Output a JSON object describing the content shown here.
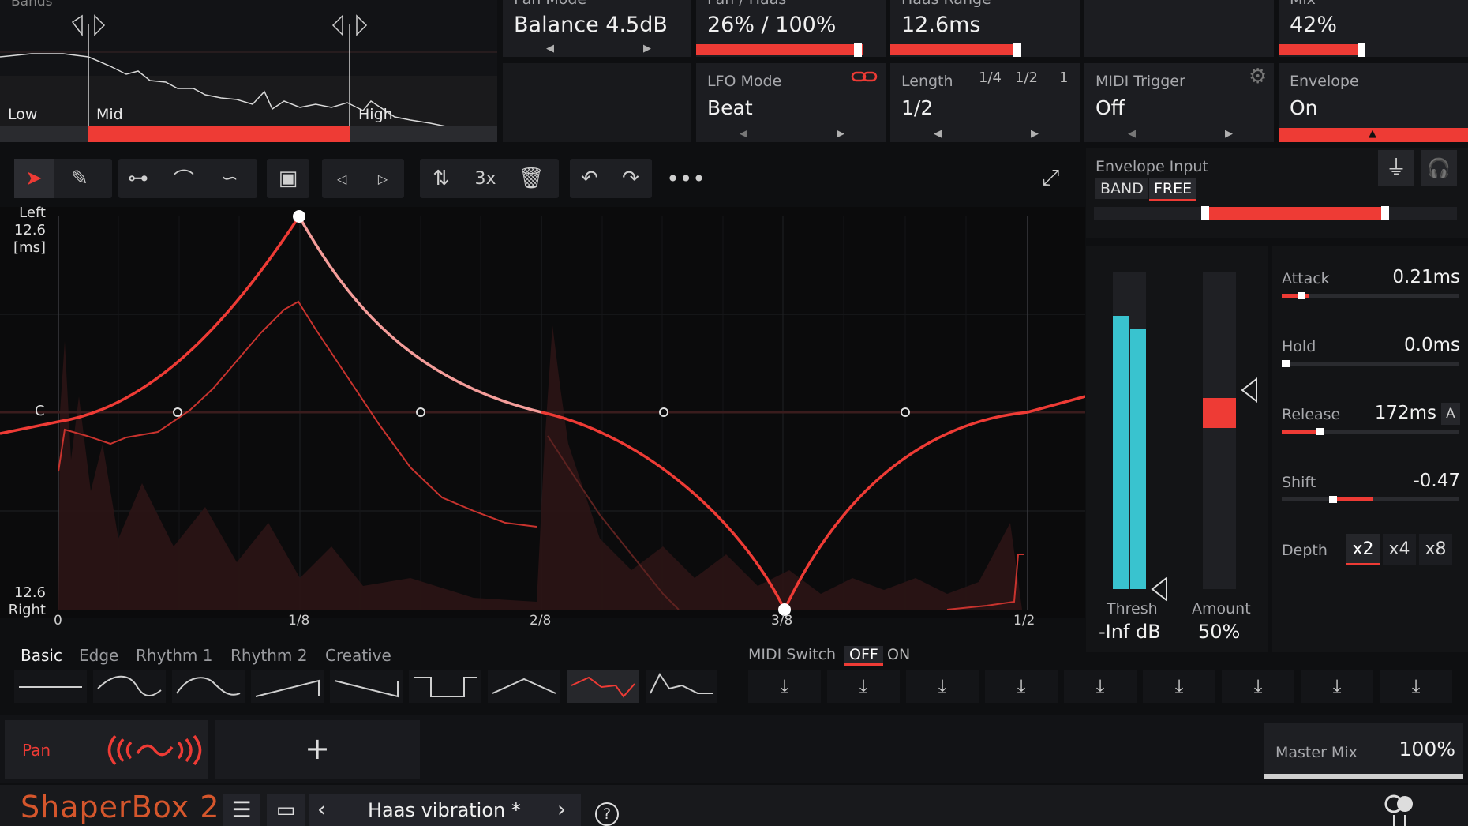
{
  "top": {
    "bands": {
      "title": "Bands",
      "labels": [
        "Low",
        "Mid",
        "High"
      ]
    },
    "pan_mode": {
      "label": "Pan Mode",
      "value": "Balance 4.5dB"
    },
    "pan_haas": {
      "label": "Pan / Haas",
      "value": "26% / 100%",
      "fill": 0.95
    },
    "haas_range": {
      "label": "Haas Range",
      "value": "12.6ms",
      "fill": 0.66
    },
    "mix": {
      "label": "Mix",
      "value": "42%",
      "fill": 0.42
    },
    "lfo_mode": {
      "label": "LFO Mode",
      "value": "Beat"
    },
    "length": {
      "label": "Length",
      "value": "1/2",
      "options": [
        "1/4",
        "1/2",
        "1"
      ]
    },
    "midi_trigger": {
      "label": "MIDI Trigger",
      "value": "Off"
    },
    "envelope": {
      "label": "Envelope",
      "value": "On"
    }
  },
  "toolbar": {
    "multiplier": "3x",
    "icons": [
      "pointer-icon",
      "pencil-icon",
      "line-icon",
      "curve-icon",
      "s-curve-icon",
      "select-all-icon",
      "nudge-left-icon",
      "nudge-right-icon",
      "flip-icon",
      "delete-icon",
      "undo-icon",
      "redo-icon",
      "more-icon",
      "expand-icon"
    ]
  },
  "graph": {
    "y_top": [
      "Left",
      "12.6",
      "[ms]"
    ],
    "y_mid": "C",
    "y_bottom": [
      "12.6",
      "Right"
    ],
    "x_ticks": [
      "0",
      "1/8",
      "2/8",
      "3/8",
      "1/2"
    ]
  },
  "shape_tabs": [
    "Basic",
    "Edge",
    "Rhythm 1",
    "Rhythm 2",
    "Creative"
  ],
  "midi_switch": {
    "label": "MIDI Switch",
    "off": "OFF",
    "on": "ON"
  },
  "envelope_panel": {
    "input_label": "Envelope Input",
    "band": "BAND",
    "free": "FREE",
    "thresh_label": "Thresh",
    "thresh_value": "-Inf dB",
    "amount_label": "Amount",
    "amount_value": "50%",
    "attack_label": "Attack",
    "attack_value": "0.21ms",
    "hold_label": "Hold",
    "hold_value": "0.0ms",
    "release_label": "Release",
    "release_value": "172ms",
    "release_auto": "A",
    "shift_label": "Shift",
    "shift_value": "-0.47",
    "depth_label": "Depth",
    "depth_options": [
      "x2",
      "x4",
      "x8"
    ]
  },
  "bottom": {
    "module_name": "Pan",
    "add": "+",
    "master_mix_label": "Master Mix",
    "master_mix_value": "100%",
    "brand": "ShaperBox 2",
    "preset_name": "Haas vibration *",
    "prev": "‹",
    "next": "›",
    "help": "?"
  },
  "colors": {
    "accent": "#ee3b35",
    "meter": "#39c3cf",
    "brand": "#d5562c"
  }
}
